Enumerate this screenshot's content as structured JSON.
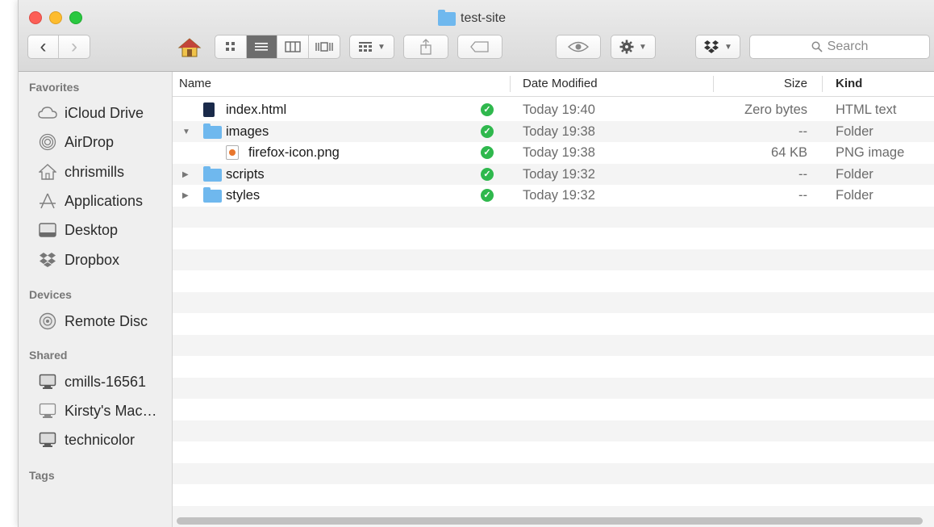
{
  "window": {
    "title": "test-site"
  },
  "toolbar": {
    "back_glyph": "‹",
    "forward_glyph": "›",
    "view_modes": [
      "icon-view",
      "list-view",
      "column-view",
      "cover-flow-view"
    ],
    "active_view": "list-view",
    "search_placeholder": "Search"
  },
  "sidebar": {
    "favorites_heading": "Favorites",
    "favorites": [
      {
        "label": "iCloud Drive",
        "icon": "cloud-icon"
      },
      {
        "label": "AirDrop",
        "icon": "airdrop-icon"
      },
      {
        "label": "chrismills",
        "icon": "home-icon"
      },
      {
        "label": "Applications",
        "icon": "applications-icon"
      },
      {
        "label": "Desktop",
        "icon": "desktop-icon"
      },
      {
        "label": "Dropbox",
        "icon": "dropbox-icon"
      }
    ],
    "devices_heading": "Devices",
    "devices": [
      {
        "label": "Remote Disc",
        "icon": "disc-icon"
      }
    ],
    "shared_heading": "Shared",
    "shared": [
      {
        "label": "cmills-16561",
        "icon": "computer-icon"
      },
      {
        "label": "Kirsty's Mac…",
        "icon": "computer-icon"
      },
      {
        "label": "technicolor",
        "icon": "computer-icon"
      }
    ],
    "tags_heading": "Tags"
  },
  "list": {
    "columns": {
      "name": "Name",
      "date": "Date Modified",
      "size": "Size",
      "kind": "Kind"
    },
    "rows": [
      {
        "name": "index.html",
        "date": "Today 19:40",
        "size": "Zero bytes",
        "kind": "HTML text",
        "type": "html",
        "disclosure": ""
      },
      {
        "name": "images",
        "date": "Today 19:38",
        "size": "--",
        "kind": "Folder",
        "type": "folder",
        "disclosure": "▼"
      },
      {
        "name": "firefox-icon.png",
        "date": "Today 19:38",
        "size": "64 KB",
        "kind": "PNG image",
        "type": "png",
        "disclosure": ""
      },
      {
        "name": "scripts",
        "date": "Today 19:32",
        "size": "--",
        "kind": "Folder",
        "type": "folder",
        "disclosure": "▶"
      },
      {
        "name": "styles",
        "date": "Today 19:32",
        "size": "--",
        "kind": "Folder",
        "type": "folder",
        "disclosure": "▶"
      }
    ],
    "sync_status": "synced",
    "sync_glyph": "✓"
  }
}
